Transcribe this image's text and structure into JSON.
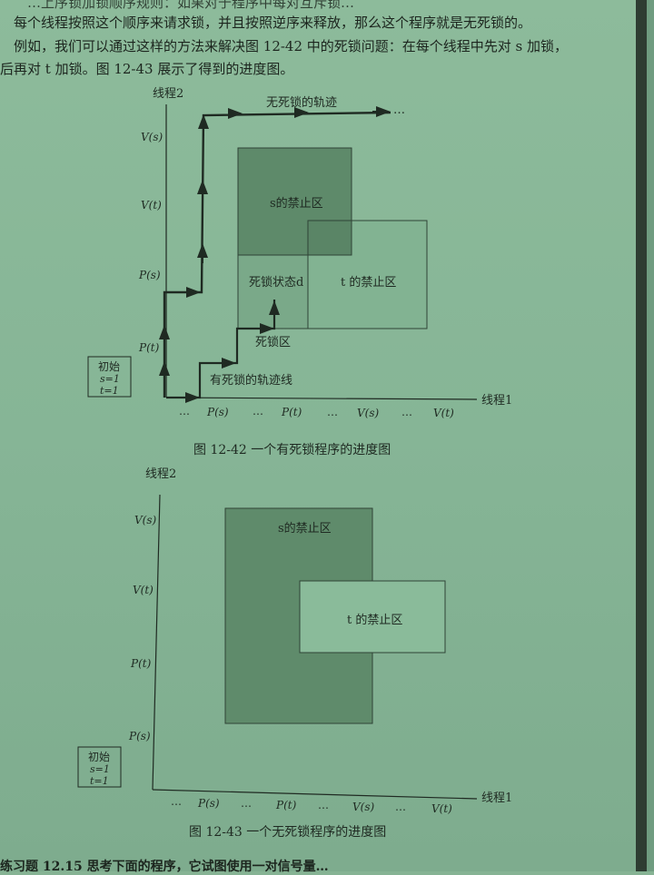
{
  "text": {
    "line0": "…上序锁加锁顺序规则：如果对于程序中每对互斥锁…",
    "line1": "每个线程按照这个顺序来请求锁，并且按照逆序来释放，那么这个程序就是无死锁的。",
    "line2": "例如，我们可以通过这样的方法来解决图 12-42 中的死锁问题：在每个线程中先对 s 加锁，",
    "line3": "后再对 t 加锁。图 12-43 展示了得到的进度图。"
  },
  "fig1": {
    "y_axis_label": "线程2",
    "x_axis_label": "线程1",
    "y_ticks": [
      "V(s)",
      "V(t)",
      "P(s)",
      "P(t)"
    ],
    "x_ticks": [
      "P(s)",
      "P(t)",
      "V(s)",
      "V(t)"
    ],
    "ellipsis": "…",
    "safe_trajectory_label": "无死锁的轨迹",
    "s_region_label": "s的禁止区",
    "t_region_label": "t 的禁止区",
    "deadlock_state_label": "死锁状态d",
    "deadlock_region_label": "死锁区",
    "deadlock_trajectory_label": "有死锁的轨迹线",
    "initial_box": [
      "初始",
      "s=1",
      "t=1"
    ],
    "caption": "图 12-42   一个有死锁程序的进度图"
  },
  "fig2": {
    "y_axis_label": "线程2",
    "x_axis_label": "线程1",
    "y_ticks": [
      "V(s)",
      "V(t)",
      "P(t)",
      "P(s)"
    ],
    "x_ticks": [
      "P(s)",
      "P(t)",
      "V(s)",
      "V(t)"
    ],
    "ellipsis": "…",
    "s_region_label": "s的禁止区",
    "t_region_label": "t 的禁止区",
    "initial_box": [
      "初始",
      "s=1",
      "t=1"
    ],
    "caption": "图 12-43   一个无死锁程序的进度图"
  },
  "footer": {
    "exercise": "练习题 12.15   思考下面的程序，它试图使用一对信号量…"
  },
  "colors": {
    "paper": "#8dbb9b",
    "s_region": "#5e8a6a",
    "t_region": "#7eae8d",
    "ink": "#1f2a22"
  }
}
